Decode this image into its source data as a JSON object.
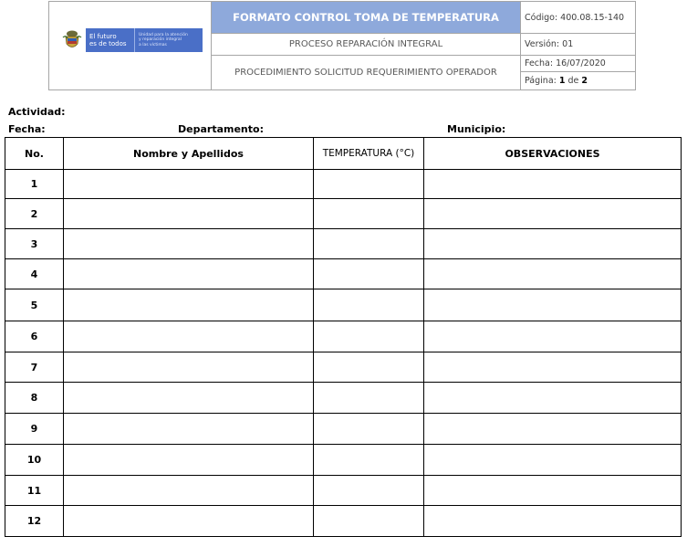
{
  "header": {
    "logo": {
      "text_left_1": "El futuro",
      "text_left_2": "es de todos",
      "text_right_1": "Unidad para la atención",
      "text_right_2": "y reparación integral",
      "text_right_3": "a las víctimas",
      "color": "#4a6fc7"
    },
    "title": "FORMATO CONTROL TOMA DE TEMPERATURA",
    "process": "PROCESO REPARACIÓN INTEGRAL",
    "procedure": "PROCEDIMIENTO SOLICITUD REQUERIMIENTO OPERADOR",
    "codigo": "Código: 400.08.15-140",
    "version": "Versión: 01",
    "fecha": "Fecha: 16/07/2020",
    "pagina": {
      "prefix": "Página:",
      "current": "1",
      "sep": "de",
      "total": "2"
    },
    "title_bg": "#8ea9db"
  },
  "form": {
    "actividad_label": "Actividad:",
    "fecha_label": "Fecha:",
    "departamento_label": "Departamento:",
    "municipio_label": "Municipio:"
  },
  "table": {
    "columns": [
      "No.",
      "Nombre y Apellidos",
      "TEMPERATURA (°C)",
      "OBSERVACIONES"
    ],
    "rows": [
      {
        "no": "1",
        "nombre": "",
        "temperatura": "",
        "observaciones": ""
      },
      {
        "no": "2",
        "nombre": "",
        "temperatura": "",
        "observaciones": ""
      },
      {
        "no": "3",
        "nombre": "",
        "temperatura": "",
        "observaciones": ""
      },
      {
        "no": "4",
        "nombre": "",
        "temperatura": "",
        "observaciones": ""
      },
      {
        "no": "5",
        "nombre": "",
        "temperatura": "",
        "observaciones": ""
      },
      {
        "no": "6",
        "nombre": "",
        "temperatura": "",
        "observaciones": ""
      },
      {
        "no": "7",
        "nombre": "",
        "temperatura": "",
        "observaciones": ""
      },
      {
        "no": "8",
        "nombre": "",
        "temperatura": "",
        "observaciones": ""
      },
      {
        "no": "9",
        "nombre": "",
        "temperatura": "",
        "observaciones": ""
      },
      {
        "no": "10",
        "nombre": "",
        "temperatura": "",
        "observaciones": ""
      },
      {
        "no": "11",
        "nombre": "",
        "temperatura": "",
        "observaciones": ""
      },
      {
        "no": "12",
        "nombre": "",
        "temperatura": "",
        "observaciones": ""
      }
    ]
  }
}
